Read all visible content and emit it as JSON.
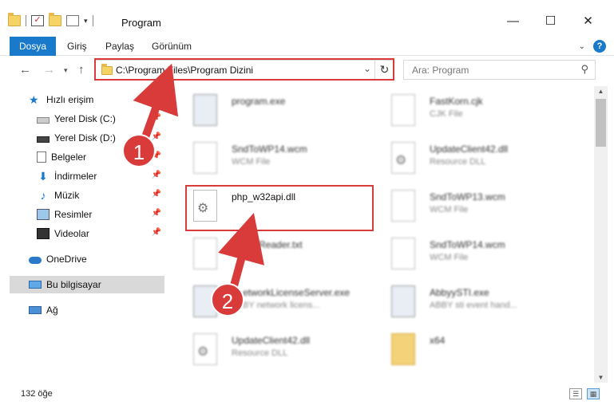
{
  "window": {
    "title": "Program",
    "minimize": "—",
    "maximize": "☐",
    "close": "✕"
  },
  "ribbon": {
    "tabs": [
      "Dosya",
      "Giriş",
      "Paylaş",
      "Görünüm"
    ],
    "help": "?"
  },
  "address": {
    "path": "C:\\Program Files\\Program Dizini"
  },
  "search": {
    "placeholder": "Ara: Program"
  },
  "sidebar": {
    "items": [
      {
        "label": "Hızlı erişim",
        "icon": "star-icon"
      },
      {
        "label": "Yerel Disk (C:)",
        "icon": "disk-icon"
      },
      {
        "label": "Yerel Disk (D:)",
        "icon": "disk-icon"
      },
      {
        "label": "Belgeler",
        "icon": "documents-icon"
      },
      {
        "label": "İndirmeler",
        "icon": "downloads-icon"
      },
      {
        "label": "Müzik",
        "icon": "music-icon"
      },
      {
        "label": "Resimler",
        "icon": "pictures-icon"
      },
      {
        "label": "Videolar",
        "icon": "videos-icon"
      },
      {
        "label": "OneDrive",
        "icon": "onedrive-icon"
      },
      {
        "label": "Bu bilgisayar",
        "icon": "this-pc-icon"
      },
      {
        "label": "Ağ",
        "icon": "network-icon"
      }
    ]
  },
  "files": {
    "left": [
      {
        "name": "program.exe",
        "type": ""
      },
      {
        "name": "SndToWP14.wcm",
        "type": "WCM File"
      },
      {
        "name": "php_w32api.dll",
        "type": ""
      },
      {
        "name": "ineReader.txt",
        "type": "T"
      },
      {
        "name": "etworkLicenseServer.exe",
        "type": "BY network licens..."
      },
      {
        "name": "UpdateClient42.dll",
        "type": "Resource DLL"
      }
    ],
    "right": [
      {
        "name": "FastKorn.cjk",
        "type": "CJK File"
      },
      {
        "name": "UpdateClient42.dll",
        "type": "Resource DLL"
      },
      {
        "name": "SndToWP13.wcm",
        "type": "WCM File"
      },
      {
        "name": "SndToWP14.wcm",
        "type": "WCM File"
      },
      {
        "name": "AbbyySTI.exe",
        "type": "ABBY sti event hand..."
      },
      {
        "name": "x64",
        "type": ""
      }
    ]
  },
  "status": {
    "count": "132 öğe"
  },
  "callouts": {
    "one": "1",
    "two": "2"
  },
  "colors": {
    "accent": "#1979ca",
    "callout": "#d93a3a"
  }
}
